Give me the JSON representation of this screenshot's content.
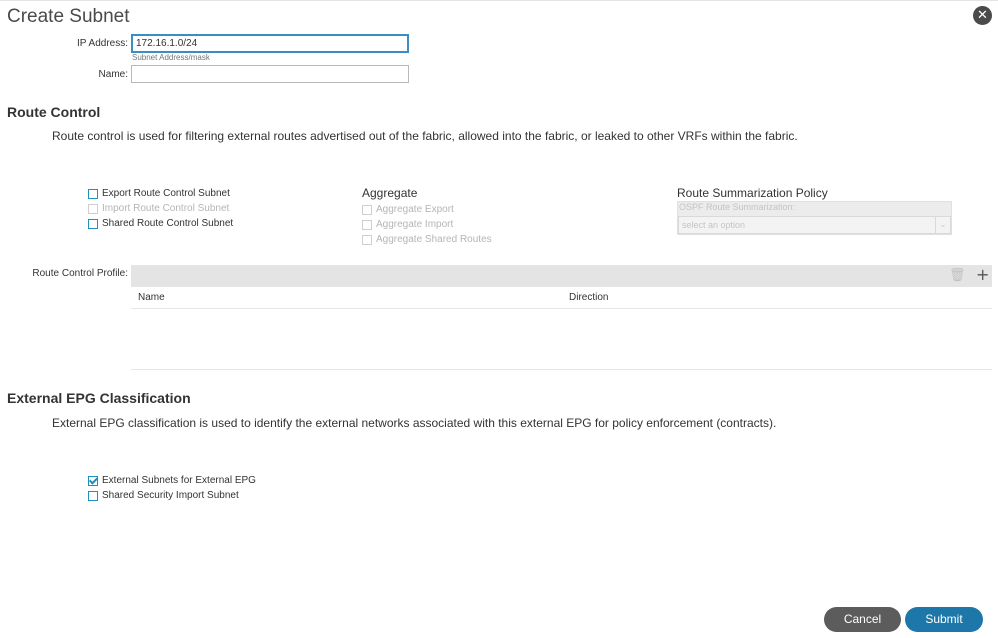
{
  "dialog": {
    "title": "Create Subnet",
    "close_icon": "close-icon"
  },
  "form": {
    "ip_label": "IP Address:",
    "ip_value": "172.16.1.0/24",
    "ip_hint": "Subnet Address/mask",
    "name_label": "Name:",
    "name_value": ""
  },
  "route_control": {
    "title": "Route Control",
    "description": "Route control is used for filtering external routes advertised out of the fabric, allowed into the fabric, or leaked to other VRFs within the fabric.",
    "checkboxes": [
      {
        "label": "Export Route Control Subnet",
        "checked": false,
        "disabled": false
      },
      {
        "label": "Import Route Control Subnet",
        "checked": false,
        "disabled": true
      },
      {
        "label": "Shared Route Control Subnet",
        "checked": false,
        "disabled": false
      }
    ],
    "aggregate": {
      "title": "Aggregate",
      "items": [
        {
          "label": "Aggregate Export",
          "checked": false,
          "disabled": true
        },
        {
          "label": "Aggregate Import",
          "checked": false,
          "disabled": true
        },
        {
          "label": "Aggregate Shared Routes",
          "checked": false,
          "disabled": true
        }
      ]
    },
    "summarization": {
      "title": "Route Summarization Policy",
      "field_label": "OSPF Route Summarization:",
      "placeholder": "select an option"
    },
    "profile": {
      "label": "Route Control Profile:",
      "columns": [
        "Name",
        "Direction"
      ],
      "rows": []
    }
  },
  "external_epg": {
    "title": "External EPG Classification",
    "description": "External EPG classification is used to identify the external networks associated with this external EPG for policy enforcement (contracts).",
    "checkboxes": [
      {
        "label": "External Subnets for External EPG",
        "checked": true,
        "disabled": false
      },
      {
        "label": "Shared Security Import Subnet",
        "checked": false,
        "disabled": false
      }
    ]
  },
  "footer": {
    "cancel_label": "Cancel",
    "submit_label": "Submit"
  },
  "colors": {
    "accent": "#1e77a9",
    "checkbox_border": "#1f8fbd",
    "cancel_bg": "#5c5c5c"
  }
}
